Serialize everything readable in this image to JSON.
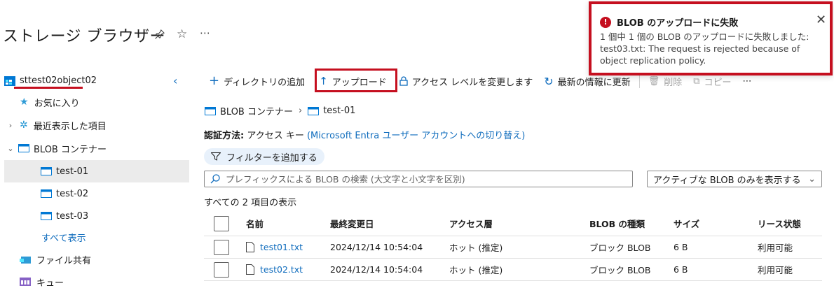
{
  "header": {
    "title": "ストレージ ブラウザー",
    "pin_icon": "pin-icon",
    "star_icon": "star-icon",
    "more": "⋯"
  },
  "sidebar": {
    "account": "sttest02object02",
    "items": [
      {
        "label": "お気に入り",
        "icon": "star-icon"
      },
      {
        "label": "最近表示した項目",
        "icon": "gear-icon"
      },
      {
        "label": "BLOB コンテナー",
        "icon": "container-icon"
      },
      {
        "label": "test-01",
        "icon": "container-icon"
      },
      {
        "label": "test-02",
        "icon": "container-icon"
      },
      {
        "label": "test-03",
        "icon": "container-icon"
      },
      {
        "label": "すべて表示"
      },
      {
        "label": "ファイル共有",
        "icon": "file-share-icon"
      },
      {
        "label": "キュー",
        "icon": "queue-icon"
      }
    ]
  },
  "toolbar": {
    "add_directory": "ディレクトリの追加",
    "upload": "アップロード",
    "access_level": "アクセス レベルを変更します",
    "refresh": "最新の情報に更新",
    "delete": "削除",
    "copy": "コピー",
    "more": "⋯"
  },
  "breadcrumb": {
    "root": "BLOB コンテナー",
    "current": "test-01"
  },
  "auth": {
    "label": "認証方法:",
    "value": "アクセス キー",
    "link": "(Microsoft Entra ユーザー アカウントへの切り替え)"
  },
  "filter": {
    "label": "フィルターを追加する"
  },
  "search": {
    "placeholder": "プレフィックスによる BLOB の検索 (大文字と小文字を区別)"
  },
  "select": {
    "value": "アクティブな BLOB のみを表示する"
  },
  "list": {
    "count_text": "すべての 2 項目の表示",
    "columns": [
      "名前",
      "最終変更日",
      "アクセス層",
      "BLOB の種類",
      "サイズ",
      "リース状態"
    ],
    "rows": [
      {
        "name": "test01.txt",
        "modified": "2024/12/14 10:54:04",
        "tier": "ホット (推定)",
        "type": "ブロック BLOB",
        "size": "6 B",
        "lease": "利用可能"
      },
      {
        "name": "test02.txt",
        "modified": "2024/12/14 10:54:04",
        "tier": "ホット (推定)",
        "type": "ブロック BLOB",
        "size": "6 B",
        "lease": "利用可能"
      }
    ]
  },
  "toast": {
    "title": "BLOB のアップロードに失敗",
    "message": "1 個中 1 個の BLOB のアップロードに失敗しました: test03.txt: The request is rejected because of object replication policy.",
    "status_color": "#c50f1f"
  },
  "colors": {
    "accent": "#0f6cbd",
    "error": "#c50f1f"
  }
}
